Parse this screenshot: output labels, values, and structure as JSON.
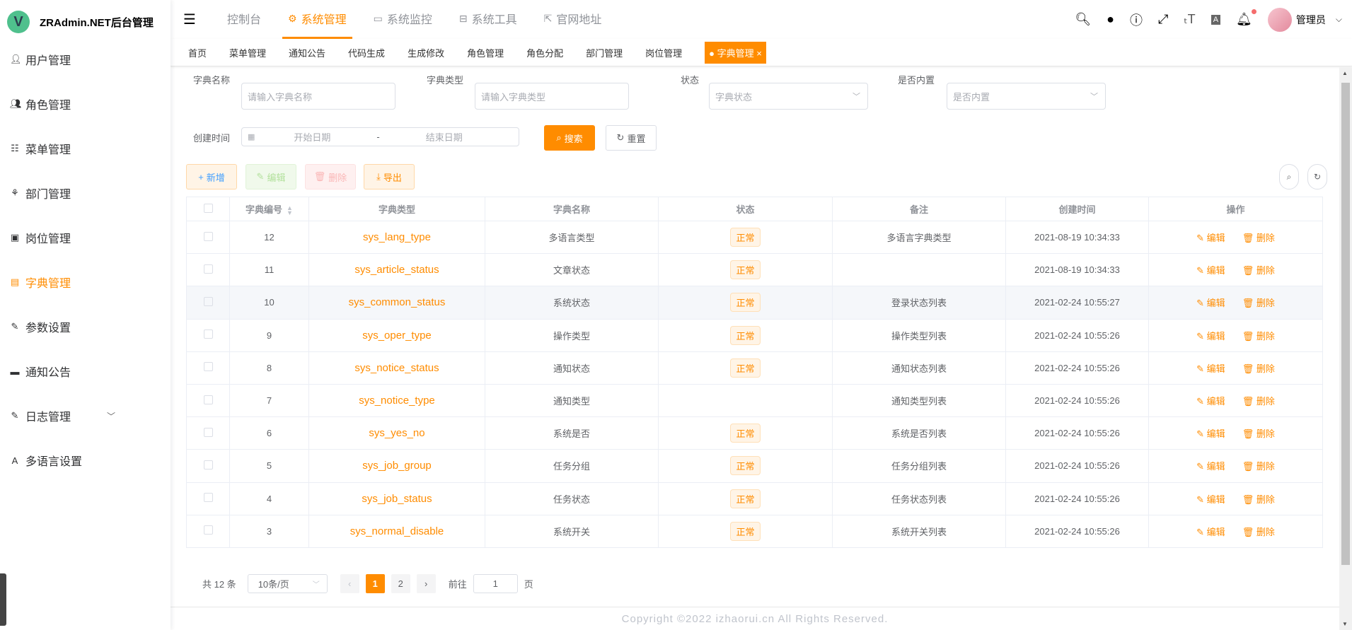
{
  "app": {
    "title": "ZRAdmin.NET后台管理",
    "logo_letter": "V"
  },
  "sidebar": {
    "items": [
      {
        "label": "用户管理",
        "icon": "user-icon"
      },
      {
        "label": "角色管理",
        "icon": "peoples-icon"
      },
      {
        "label": "菜单管理",
        "icon": "tree-table-icon"
      },
      {
        "label": "部门管理",
        "icon": "tree-icon"
      },
      {
        "label": "岗位管理",
        "icon": "post-icon"
      },
      {
        "label": "字典管理",
        "icon": "dict-icon",
        "active": true
      },
      {
        "label": "参数设置",
        "icon": "edit-icon"
      },
      {
        "label": "通知公告",
        "icon": "message-icon"
      },
      {
        "label": "日志管理",
        "icon": "log-icon",
        "expandable": true
      },
      {
        "label": "多语言设置",
        "icon": "language-icon"
      }
    ]
  },
  "header": {
    "nav": [
      {
        "label": "控制台",
        "icon": ""
      },
      {
        "label": "系统管理",
        "icon": "gear-icon",
        "active": true
      },
      {
        "label": "系统监控",
        "icon": "monitor-icon"
      },
      {
        "label": "系统工具",
        "icon": "toolbox-icon"
      },
      {
        "label": "官网地址",
        "icon": "external-link-icon"
      }
    ],
    "username": "管理员"
  },
  "tags": [
    "首页",
    "菜单管理",
    "通知公告",
    "代码生成",
    "生成修改",
    "角色管理",
    "角色分配",
    "部门管理",
    "岗位管理",
    "字典管理"
  ],
  "search": {
    "dict_name_label": "字典名称",
    "dict_name_placeholder": "请输入字典名称",
    "dict_type_label": "字典类型",
    "dict_type_placeholder": "请输入字典类型",
    "status_label": "状态",
    "status_placeholder": "字典状态",
    "builtin_label": "是否内置",
    "builtin_placeholder": "是否内置",
    "created_label": "创建时间",
    "start_placeholder": "开始日期",
    "range_sep": "-",
    "end_placeholder": "结束日期",
    "search_btn": "搜索",
    "reset_btn": "重置"
  },
  "toolbar": {
    "add": "新增",
    "edit": "编辑",
    "delete": "删除",
    "export": "导出"
  },
  "table": {
    "columns": [
      "字典编号",
      "字典类型",
      "字典名称",
      "状态",
      "备注",
      "创建时间",
      "操作"
    ],
    "edit_label": "编辑",
    "delete_label": "删除",
    "rows": [
      {
        "id": "12",
        "type": "sys_lang_type",
        "name": "多语言类型",
        "status": "正常",
        "remark": "多语言字典类型",
        "created": "2021-08-19 10:34:33"
      },
      {
        "id": "11",
        "type": "sys_article_status",
        "name": "文章状态",
        "status": "正常",
        "remark": "",
        "created": "2021-08-19 10:34:33"
      },
      {
        "id": "10",
        "type": "sys_common_status",
        "name": "系统状态",
        "status": "正常",
        "remark": "登录状态列表",
        "created": "2021-02-24 10:55:27"
      },
      {
        "id": "9",
        "type": "sys_oper_type",
        "name": "操作类型",
        "status": "正常",
        "remark": "操作类型列表",
        "created": "2021-02-24 10:55:26"
      },
      {
        "id": "8",
        "type": "sys_notice_status",
        "name": "通知状态",
        "status": "正常",
        "remark": "通知状态列表",
        "created": "2021-02-24 10:55:26"
      },
      {
        "id": "7",
        "type": "sys_notice_type",
        "name": "通知类型",
        "status": "",
        "remark": "通知类型列表",
        "created": "2021-02-24 10:55:26"
      },
      {
        "id": "6",
        "type": "sys_yes_no",
        "name": "系统是否",
        "status": "正常",
        "remark": "系统是否列表",
        "created": "2021-02-24 10:55:26"
      },
      {
        "id": "5",
        "type": "sys_job_group",
        "name": "任务分组",
        "status": "正常",
        "remark": "任务分组列表",
        "created": "2021-02-24 10:55:26"
      },
      {
        "id": "4",
        "type": "sys_job_status",
        "name": "任务状态",
        "status": "正常",
        "remark": "任务状态列表",
        "created": "2021-02-24 10:55:26"
      },
      {
        "id": "3",
        "type": "sys_normal_disable",
        "name": "系统开关",
        "status": "正常",
        "remark": "系统开关列表",
        "created": "2021-02-24 10:55:26"
      }
    ]
  },
  "pagination": {
    "total": "共 12 条",
    "page_size": "10条/页",
    "pages": [
      "1",
      "2"
    ],
    "current": "1",
    "goto_label": "前往",
    "goto_value": "1",
    "page_suffix": "页"
  },
  "footer": {
    "copyright": "Copyright ©2022 izhaorui.cn All Rights Reserved."
  },
  "colors": {
    "accent": "#ff8c00",
    "logo": "#4fc08d"
  }
}
